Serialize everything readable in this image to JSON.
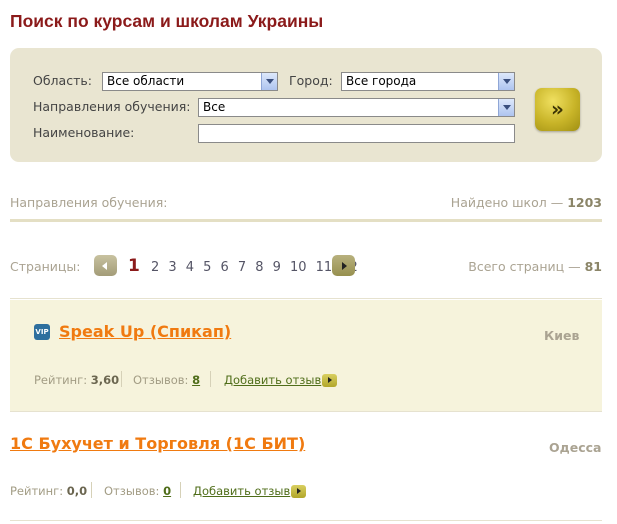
{
  "page_title": "Поиск по курсам и школам Украины",
  "search": {
    "region_label": "Область:",
    "region_value": "Все области",
    "city_label": "Город:",
    "city_value": "Все города",
    "direction_label": "Направления обучения:",
    "direction_value": "Все",
    "name_label": "Наименование:",
    "name_value": "",
    "submit_icon": "double-chevron-right-icon",
    "submit_glyph": "»"
  },
  "summary": {
    "directions_label": "Направления обучения:",
    "found_label": "Найдено школ —",
    "found_count": "1203"
  },
  "pagination": {
    "label": "Страницы:",
    "pages": [
      "1",
      "2",
      "3",
      "4",
      "5",
      "6",
      "7",
      "8",
      "9",
      "10",
      "11",
      "12"
    ],
    "current": "1",
    "total_label": "Всего страниц —",
    "total_count": "81"
  },
  "schools": [
    {
      "vip": true,
      "vip_badge": "VIP",
      "name": "Speak Up (Спикап)",
      "city": "Киев",
      "rating_label": "Рейтинг:",
      "rating": "3,60",
      "reviews_label": "Отзывов:",
      "reviews": "8",
      "add_review": "Добавить отзыв"
    },
    {
      "vip": false,
      "name": "1С Бухучет и Торговля (1С БИТ)",
      "city": "Одесса",
      "rating_label": "Рейтинг:",
      "rating": "0,0",
      "reviews_label": "Отзывов:",
      "reviews": "0",
      "add_review": "Добавить отзыв"
    }
  ],
  "colors": {
    "title": "#8b1a1a",
    "search_bg": "#e9e5d1",
    "vip_bg": "#f6f3dc",
    "school_link": "#f07a10",
    "review_link": "#4f6d19"
  }
}
